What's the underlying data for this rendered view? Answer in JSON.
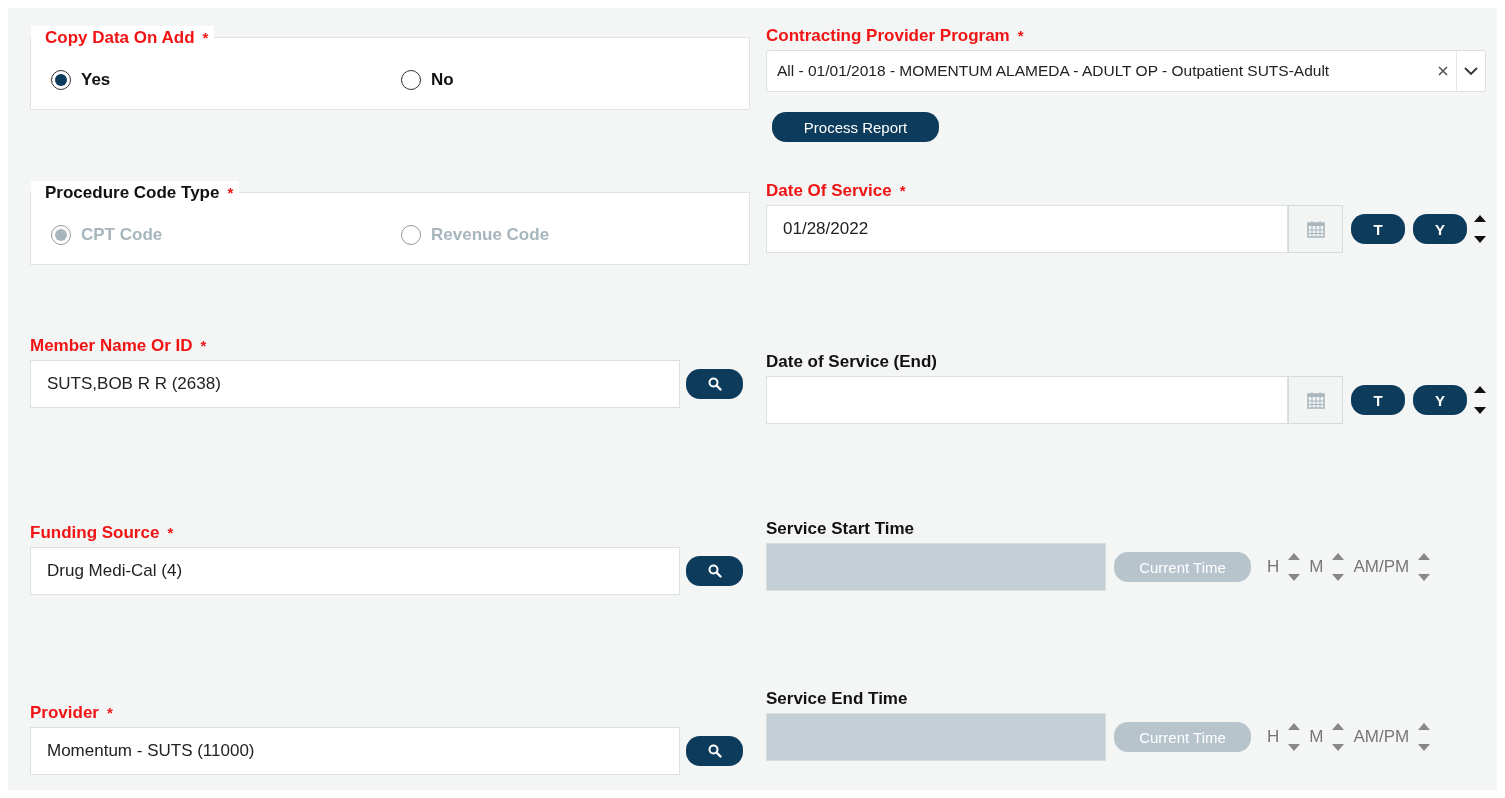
{
  "left": [
    {
      "kind": "radio_group",
      "label": "Copy Data On Add",
      "required_mark": "*",
      "invalid": true,
      "disabled": false,
      "options": [
        {
          "label": "Yes",
          "selected": true
        },
        {
          "label": "No",
          "selected": false
        }
      ]
    },
    {
      "kind": "radio_group",
      "label": "Procedure Code Type",
      "required_mark": "*",
      "invalid": false,
      "disabled": true,
      "options": [
        {
          "label": "CPT Code",
          "selected": true
        },
        {
          "label": "Revenue Code",
          "selected": false
        }
      ]
    },
    {
      "kind": "lookup",
      "label": "Member Name Or ID",
      "required_mark": "*",
      "invalid": true,
      "value": "SUTS,BOB R R (2638)"
    },
    {
      "kind": "lookup",
      "label": "Funding Source",
      "required_mark": "*",
      "invalid": true,
      "value": "Drug Medi-Cal (4)"
    },
    {
      "kind": "lookup",
      "label": "Provider",
      "required_mark": "*",
      "invalid": true,
      "value": "Momentum - SUTS (11000)"
    }
  ],
  "right": [
    {
      "kind": "select",
      "label": "Contracting Provider Program",
      "required_mark": "*",
      "invalid": true,
      "value": "All - 01/01/2018 - MOMENTUM ALAMEDA - ADULT OP - Outpatient SUTS-Adult",
      "button": "Process Report"
    },
    {
      "kind": "date",
      "label": "Date Of Service",
      "required_mark": "*",
      "invalid": true,
      "value": "01/28/2022",
      "buttons": [
        "T",
        "Y"
      ]
    },
    {
      "kind": "date",
      "label": "Date of Service (End)",
      "invalid": false,
      "buttons": [
        "T",
        "Y"
      ]
    },
    {
      "kind": "time",
      "label": "Service Start Time",
      "invalid": false,
      "disabled": true,
      "button": "Current Time",
      "units": [
        "H",
        "M",
        "AM/PM"
      ]
    },
    {
      "kind": "time",
      "label": "Service End Time",
      "invalid": false,
      "disabled": true,
      "button": "Current Time",
      "units": [
        "H",
        "M",
        "AM/PM"
      ]
    }
  ]
}
